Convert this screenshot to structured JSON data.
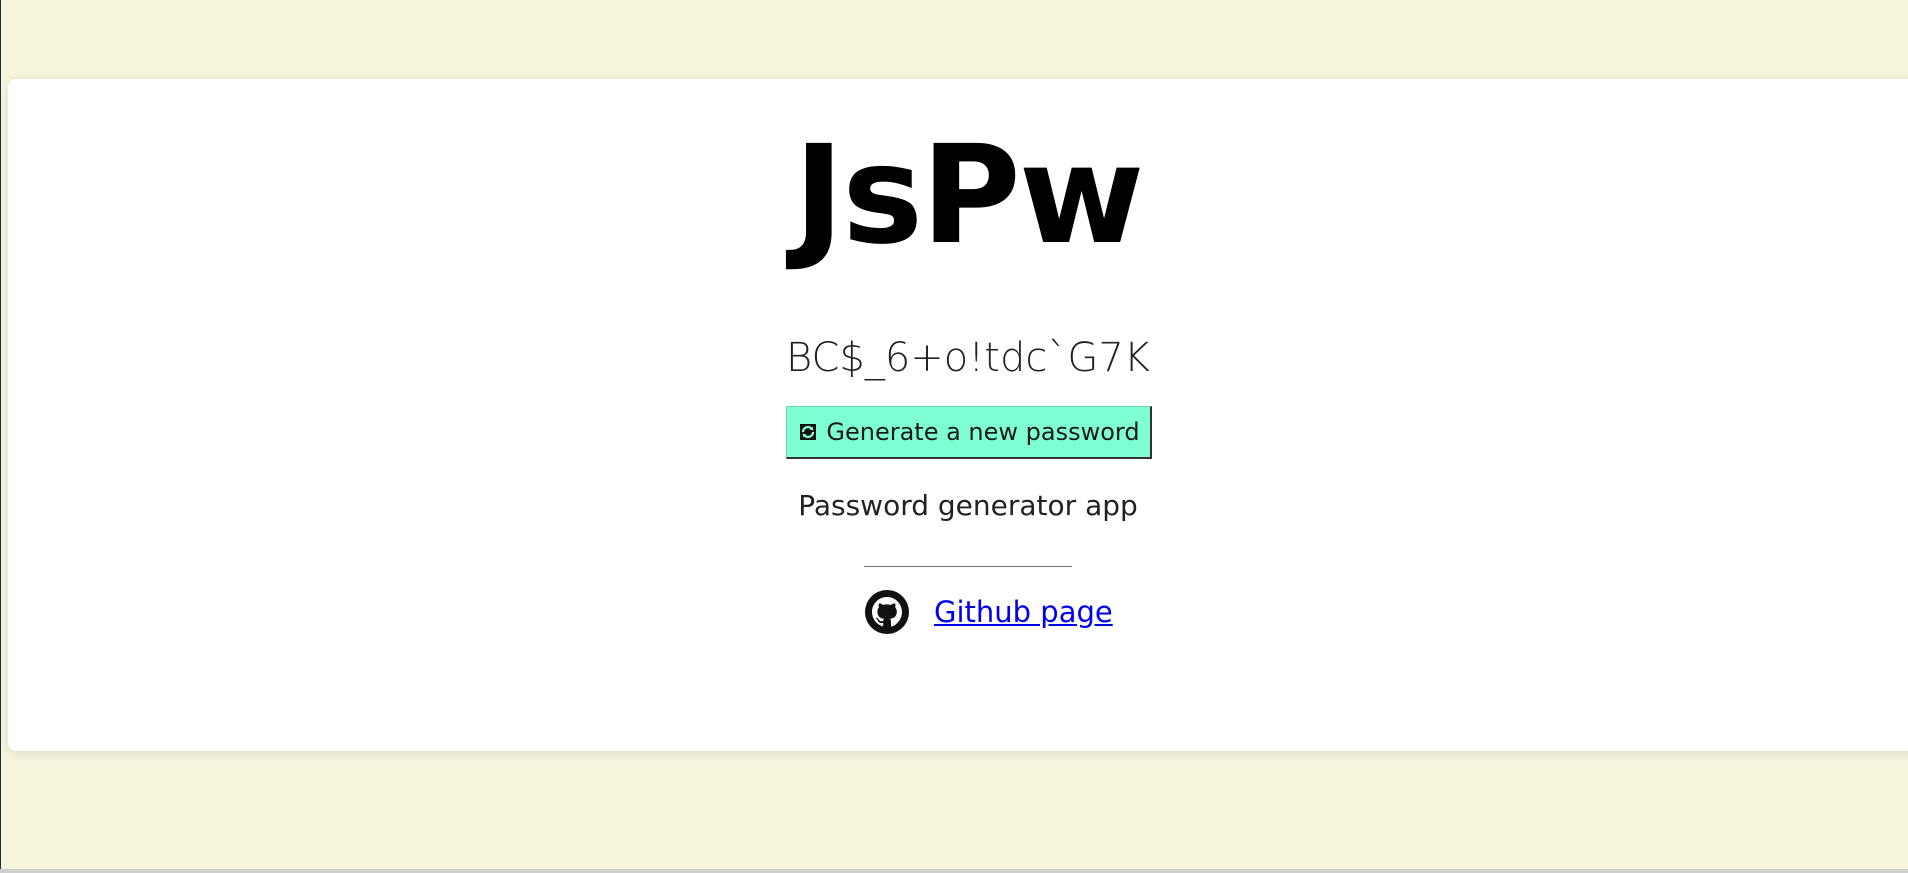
{
  "app": {
    "title": "JsPw",
    "subtitle": "Password generator app"
  },
  "password": {
    "value": "BC$_6+o!tdc`G7K"
  },
  "actions": {
    "generate_label": "Generate a new password",
    "generate_icon": "refresh-icon"
  },
  "footer": {
    "github_icon": "github-icon",
    "github_link_label": "Github page"
  },
  "colors": {
    "background": "#f5f5dc",
    "card": "#ffffff",
    "button": "#7fffd4",
    "link": "#0000ee"
  }
}
